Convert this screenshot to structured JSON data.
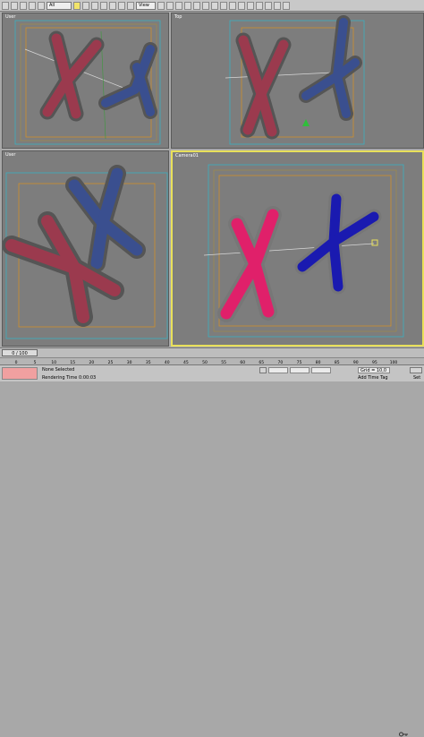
{
  "toolbar": {
    "selection_filter": "All",
    "ref_coord_system": "View"
  },
  "viewports": {
    "top_left": "User",
    "top_right": "Top",
    "bottom_left": "User",
    "bottom_right": "Camera01"
  },
  "timeline": {
    "frame": "0 / 100",
    "ticks": [
      "0",
      "5",
      "10",
      "15",
      "20",
      "25",
      "30",
      "35",
      "40",
      "45",
      "50",
      "55",
      "60",
      "65",
      "70",
      "75",
      "80",
      "85",
      "90",
      "95",
      "100"
    ]
  },
  "status": {
    "selection": "None Selected",
    "prompt": "Rendering Time 0:00:03",
    "grid": "Grid = 10,0",
    "add_time_tag": "Add Time Tag",
    "set_key": "Set"
  },
  "colors": {
    "red_chromosome": "#9b3a4e",
    "blue_chromosome": "#3a4f8f",
    "pink_render": "#e0206a",
    "blue_render": "#1a1ab0",
    "viewport_bg": "#7d7d7d",
    "active_border": "#e8e05a"
  },
  "icons": [
    "select-object-icon",
    "move-icon",
    "rotate-icon",
    "scale-icon",
    "snap-icon",
    "mirror-icon",
    "align-icon",
    "render-icon",
    "key-icon"
  ]
}
